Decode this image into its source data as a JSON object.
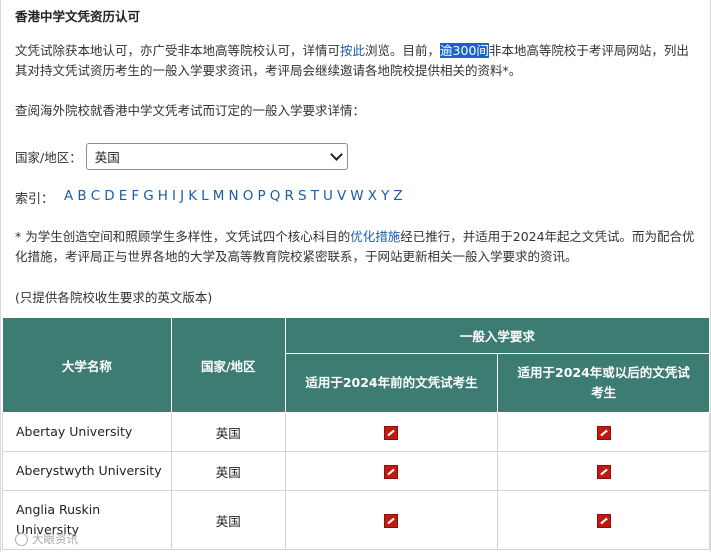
{
  "title": "香港中学文凭资历认可",
  "para1": {
    "part1": "文凭试除获本地认可，亦广受非本地高等院校认可，详情可",
    "link1": "按此",
    "part2": "浏览。目前，",
    "highlight": "逾300间",
    "part3": "非本地高等院校于考评局网站，列出其对持文凭试资历考生的一般入学要求资讯，考评局会继续邀请各地院校提供相关的资料*。"
  },
  "para2": "查阅海外院校就香港中学文凭考试而订定的一般入学要求详情：",
  "country": {
    "label": "国家/地区：",
    "selected": "英国"
  },
  "index": {
    "label": "索引：",
    "letters": [
      "A",
      "B",
      "C",
      "D",
      "E",
      "F",
      "G",
      "H",
      "I",
      "J",
      "K",
      "L",
      "M",
      "N",
      "O",
      "P",
      "Q",
      "R",
      "S",
      "T",
      "U",
      "V",
      "W",
      "X",
      "Y",
      "Z"
    ]
  },
  "para3": {
    "part1": "* 为学生创造空间和照顾学生多样性，文凭试四个核心科目的",
    "link": "优化措施",
    "part2": "经已推行，并适用于2024年起之文凭试。而为配合优化措施，考评局正与世界各地的大学及高等教育院校紧密联系，于网站更新相关一般入学要求的资讯。"
  },
  "para4": "(只提供各院校收生要求的英文版本)",
  "table": {
    "col_university": "大学名称",
    "col_country": "国家/地区",
    "col_requirements": "一般入学要求",
    "col_before_2024": "适用于2024年前的文凭试考生",
    "col_from_2024": "适用于2024年或以后的文凭试考生",
    "rows": [
      {
        "name": "Abertay University",
        "country": "英国"
      },
      {
        "name": "Aberystwyth University",
        "country": "英国"
      },
      {
        "name": "Anglia Ruskin University",
        "country": "英国"
      }
    ]
  },
  "watermark": "大眼资讯"
}
